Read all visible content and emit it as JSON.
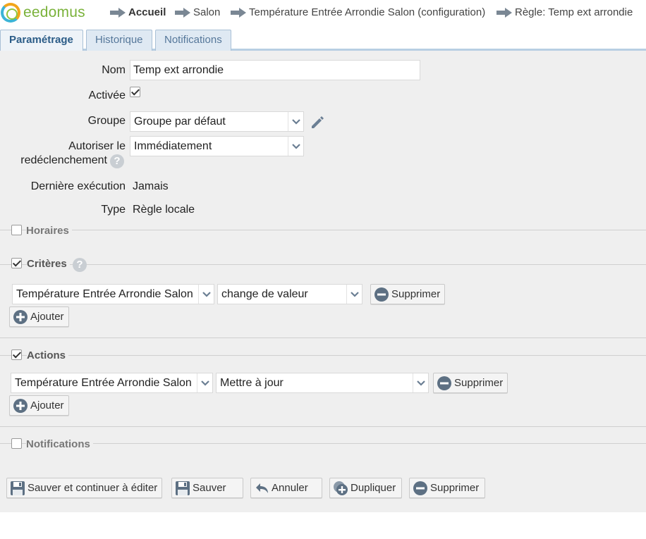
{
  "app": {
    "logo_text": "eedomus"
  },
  "breadcrumb": [
    {
      "label": "Accueil"
    },
    {
      "label": "Salon"
    },
    {
      "label": "Température Entrée Arrondie Salon (configuration)"
    },
    {
      "label": "Règle: Temp ext arrondie"
    }
  ],
  "tabs": [
    {
      "label": "Paramétrage",
      "active": true
    },
    {
      "label": "Historique"
    },
    {
      "label": "Notifications"
    }
  ],
  "form": {
    "nom_label": "Nom",
    "nom_value": "Temp ext arrondie",
    "activee_label": "Activée",
    "activee_checked": true,
    "groupe_label": "Groupe",
    "groupe_value": "Groupe par défaut",
    "autoriser_label_1": "Autoriser le",
    "autoriser_label_2": "redéclenchement",
    "autoriser_value": "Immédiatement",
    "derniere_label": "Dernière exécution",
    "derniere_value": "Jamais",
    "type_label": "Type",
    "type_value": "Règle locale"
  },
  "sections": {
    "horaires": {
      "title": "Horaires",
      "checked": false
    },
    "criteres": {
      "title": "Critères",
      "checked": true
    },
    "actions": {
      "title": "Actions",
      "checked": true
    },
    "notifications": {
      "title": "Notifications",
      "checked": false
    }
  },
  "criteres_row": {
    "device": "Température Entrée Arrondie Salon",
    "condition": "change de valeur",
    "remove_label": "Supprimer",
    "add_label": "Ajouter"
  },
  "actions_row": {
    "device": "Température Entrée Arrondie Salon",
    "action": "Mettre à jour",
    "remove_label": "Supprimer",
    "add_label": "Ajouter"
  },
  "footer_buttons": {
    "save_continue": "Sauver et continuer à éditer",
    "save": "Sauver",
    "cancel": "Annuler",
    "duplicate": "Dupliquer",
    "delete": "Supprimer"
  },
  "help_glyph": "?",
  "colors": {
    "tab_accent": "#b8cfe3",
    "panel_bg": "#efefef",
    "logo_green": "#7ab23a"
  }
}
